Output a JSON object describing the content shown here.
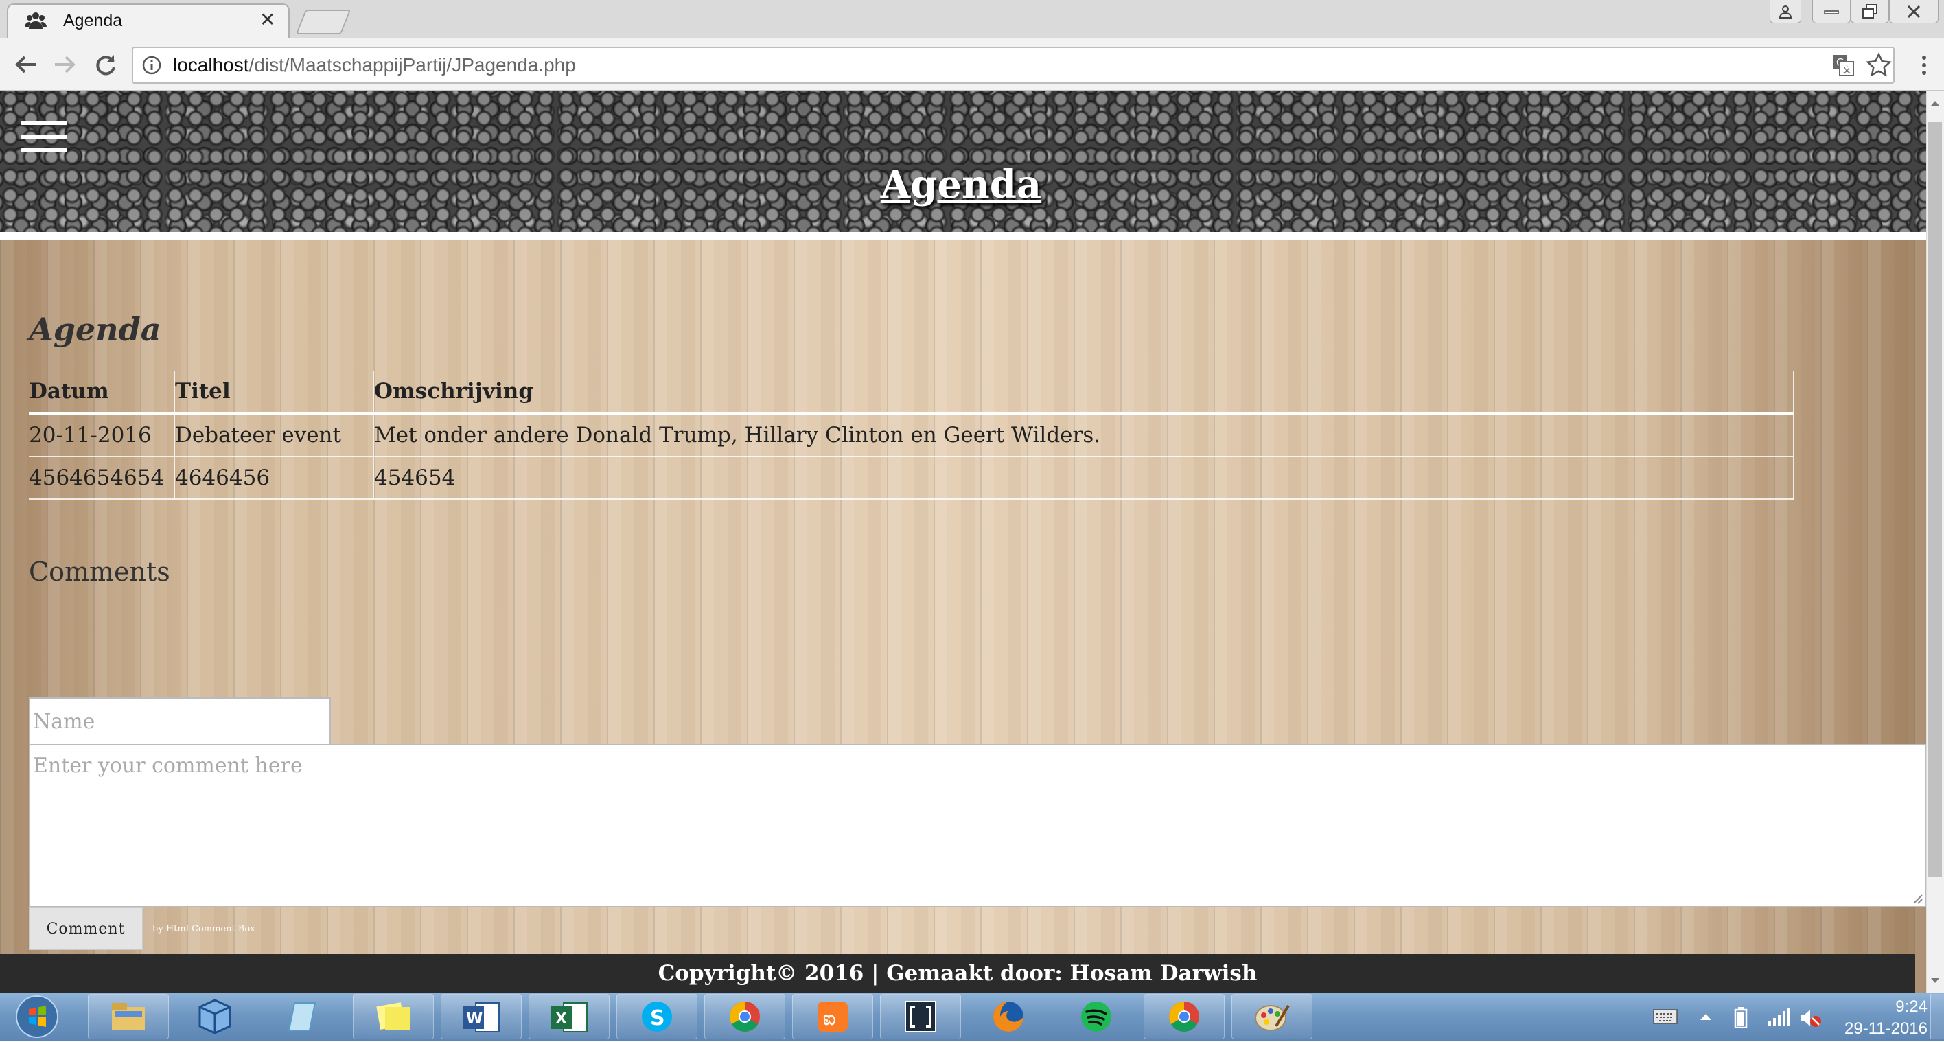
{
  "browser": {
    "tab_title": "Agenda",
    "tab_close_glyph": "✕",
    "url_host": "localhost",
    "url_path": "/dist/MaatschappijPartij/JPagenda.php"
  },
  "page": {
    "hero_title": "Agenda",
    "agenda_heading": "Agenda",
    "table": {
      "headers": [
        "Datum",
        "Titel",
        "Omschrijving"
      ],
      "rows": [
        [
          "20-11-2016",
          "Debateer event",
          "Met onder andere Donald Trump, Hillary Clinton en Geert Wilders."
        ],
        [
          "4564654654",
          "4646456",
          "454654"
        ]
      ]
    },
    "comments": {
      "heading": "Comments",
      "name_placeholder": "Name",
      "comment_placeholder": "Enter your comment here",
      "submit_label": "Comment",
      "powered_by_prefix": "by",
      "powered_by_link": "Html Comment Box"
    },
    "footer_text": "Copyright© 2016 | Gemaakt door: Hosam Darwish"
  },
  "taskbar": {
    "apps": [
      "file-explorer",
      "3d-box-app",
      "notepad-app",
      "sticky-notes",
      "word",
      "excel",
      "skype",
      "chrome",
      "xampp",
      "bracket-app",
      "firefox",
      "spotify",
      "chrome-active",
      "paint"
    ],
    "clock_time": "9:24",
    "clock_date": "29-11-2016"
  },
  "colors": {
    "footer_bg": "#2b2b2b",
    "taskbar": "#6f97c2",
    "wood": "#d7bfa2"
  }
}
